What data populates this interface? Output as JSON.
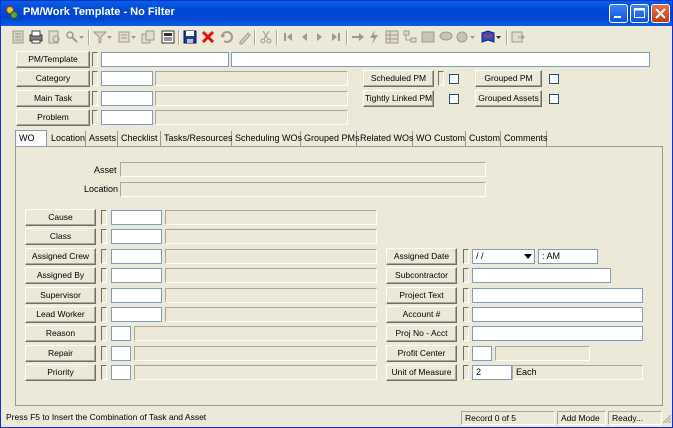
{
  "window": {
    "title": "PM/Work Template - No Filter"
  },
  "header_fields": {
    "pm_template_label": "PM/Template",
    "category_label": "Category",
    "main_task_label": "Main Task",
    "problem_label": "Problem",
    "scheduled_pm_label": "Scheduled PM",
    "grouped_pm_label": "Grouped PM",
    "tightly_linked_pm_label": "Tightly Linked PM",
    "grouped_assets_label": "Grouped Assets"
  },
  "tabs": [
    "WO",
    "Location",
    "Assets",
    "Checklist",
    "Tasks/Resources",
    "Scheduling WOs",
    "Grouped PMs",
    "Related WOs",
    "WO Custom",
    "Custom",
    "Comments"
  ],
  "wo_panel": {
    "asset_label": "Asset",
    "location_label": "Location",
    "left_buttons": [
      "Cause",
      "Class",
      "Assigned Crew",
      "Assigned By",
      "Supervisor",
      "Lead Worker",
      "Reason",
      "Repair",
      "Priority"
    ],
    "right_buttons": [
      "Assigned Date",
      "Subcontractor",
      "Project Text",
      "Account #",
      "Proj No - Acct",
      "Profit Center",
      "Unit of Measure"
    ],
    "assigned_date_value": " / /",
    "assigned_time_value": " :  AM",
    "unit_of_measure_value": "2",
    "unit_of_measure_unit": "Each"
  },
  "statusbar": {
    "message": "Press F5 to Insert the Combination of Task and Asset",
    "record": "Record 0 of 5",
    "mode": "Add Mode",
    "state": "Ready..."
  },
  "colors": {
    "titlebar": "#0047d6",
    "window_bg": "#ece9d8",
    "close_button": "#c23c13"
  }
}
